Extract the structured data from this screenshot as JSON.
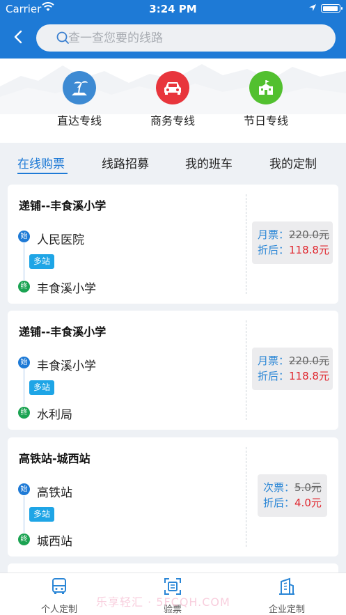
{
  "status": {
    "carrier": "Carrier",
    "time": "3:24 PM"
  },
  "search": {
    "placeholder": "查一查您要的线路"
  },
  "categories": [
    {
      "label": "直达专线",
      "icon": "island-icon",
      "color": "#3d8ad3"
    },
    {
      "label": "商务专线",
      "icon": "car-icon",
      "color": "#e8353c"
    },
    {
      "label": "节日专线",
      "icon": "building-icon",
      "color": "#52c02f"
    }
  ],
  "tabs": [
    {
      "label": "在线购票",
      "active": true
    },
    {
      "label": "线路招募"
    },
    {
      "label": "我的班车"
    },
    {
      "label": "我的定制"
    }
  ],
  "routes": [
    {
      "title": "递铺--丰食溪小学",
      "start_badge": "始",
      "start": "人民医院",
      "stops": "多站",
      "end_badge": "终",
      "end": "丰食溪小学",
      "price_label": "月票：",
      "original_price": "220.0元",
      "disc_label": "折后：",
      "discount_price": "118.8元"
    },
    {
      "title": "递铺--丰食溪小学",
      "start_badge": "始",
      "start": "丰食溪小学",
      "stops": "多站",
      "end_badge": "终",
      "end": "水利局",
      "price_label": "月票：",
      "original_price": "220.0元",
      "disc_label": "折后：",
      "discount_price": "118.8元"
    },
    {
      "title": "高铁站-城西站",
      "start_badge": "始",
      "start": "高铁站",
      "stops": "多站",
      "end_badge": "终",
      "end": "城西站",
      "price_label": "次票：",
      "original_price": "5.0元",
      "disc_label": "折后：",
      "discount_price": "4.0元"
    }
  ],
  "bottom_nav": [
    {
      "label": "个人定制",
      "icon": "bus-icon"
    },
    {
      "label": "验票",
      "icon": "scan-ticket-icon"
    },
    {
      "label": "企业定制",
      "icon": "office-building-icon"
    }
  ],
  "watermark": "乐享轻汇 · 5FCQH.COM",
  "colors": {
    "primary": "#1e7ad6",
    "discount": "#e0262e",
    "end_badge": "#1ba352",
    "stops_tag": "#1ea5e6"
  }
}
